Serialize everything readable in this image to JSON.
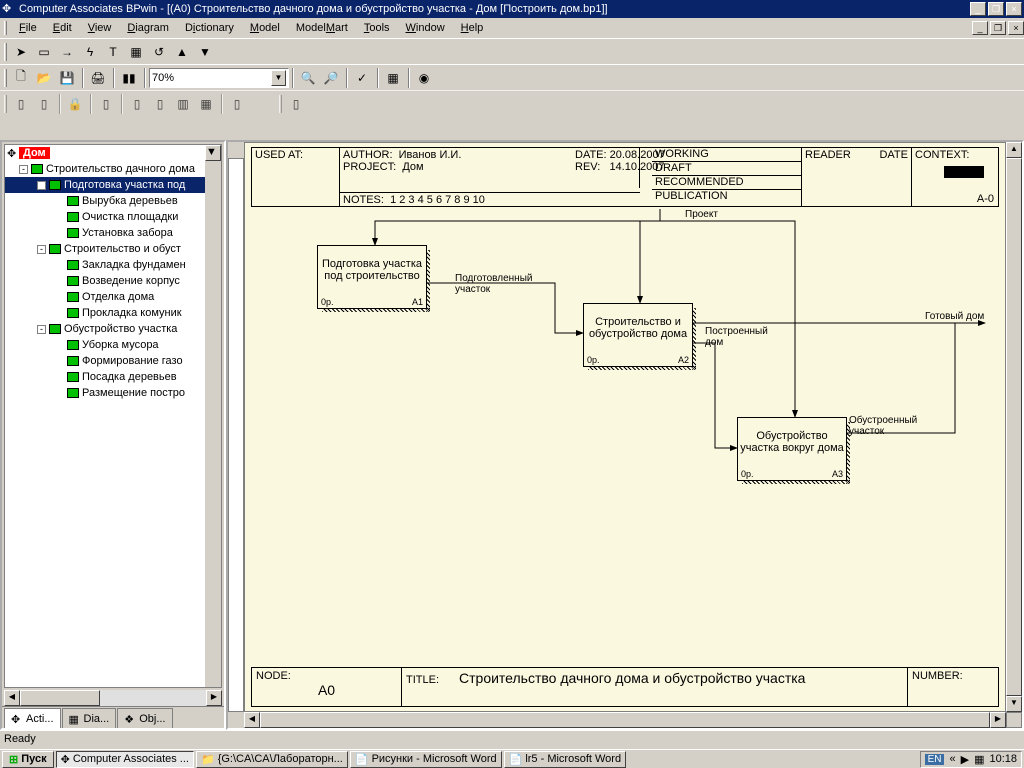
{
  "title": "Computer Associates BPwin - [(A0) Строительство дачного дома  и обустройство участка  - Дом  [Построить дом.bp1]]",
  "menu": {
    "file": "File",
    "edit": "Edit",
    "view": "View",
    "diagram": "Diagram",
    "dictionary": "Dictionary",
    "model": "Model",
    "modelmart": "ModelMart",
    "tools": "Tools",
    "window": "Window",
    "help": "Help"
  },
  "zoom": "70%",
  "tree": {
    "root": "Дом",
    "n1": "Строительство дачного дома",
    "n1_1": "Подготовка участка под",
    "n1_1_1": "Вырубка деревьев",
    "n1_1_2": "Очистка площадки",
    "n1_1_3": "Установка забора",
    "n1_2": "Строительство и обуст",
    "n1_2_1": "Закладка фундамен",
    "n1_2_2": "Возведение корпус",
    "n1_2_3": "Отделка дома",
    "n1_2_4": "Прокладка комуник",
    "n1_3": "Обустройство участка",
    "n1_3_1": "Уборка мусора",
    "n1_3_2": "Формирование газо",
    "n1_3_3": "Посадка деревьев",
    "n1_3_4": "Размещение постро"
  },
  "tabs": {
    "act": "Acti...",
    "dia": "Dia...",
    "obj": "Obj..."
  },
  "header": {
    "used_at": "USED AT:",
    "author_l": "AUTHOR:",
    "author": "Иванов И.И.",
    "project_l": "PROJECT:",
    "project": "Дом",
    "date_l": "DATE:",
    "date": "20.08.2007",
    "rev_l": "REV:",
    "rev": "14.10.2007",
    "working": "WORKING",
    "draft": "DRAFT",
    "recommended": "RECOMMENDED",
    "publication": "PUBLICATION",
    "reader": "READER",
    "hdate": "DATE",
    "context": "CONTEXT:",
    "notes_l": "NOTES:",
    "notes": "1  2  3  4  5  6  7  8  9  10",
    "a0": "A-0"
  },
  "footer": {
    "node_l": "NODE:",
    "node": "A0",
    "title_l": "TITLE:",
    "title": "Строительство дачного дома  и обустройство участка",
    "number_l": "NUMBER:"
  },
  "boxes": {
    "a1": {
      "t": "Подготовка участка под строительство",
      "bl": "0р.",
      "br": "A1"
    },
    "a2": {
      "t": "Строительство и обустройство дома",
      "bl": "0р.",
      "br": "A2"
    },
    "a3": {
      "t": "Обустройство участка вокруг дома",
      "bl": "0р.",
      "br": "A3"
    }
  },
  "labels": {
    "proekt": "Проект",
    "podgot": "Подготовленный участок",
    "postr": "Построенный дом",
    "obustr": "Обустроенный участок",
    "gotov": "Готовый дом"
  },
  "status": "Ready",
  "taskbar": {
    "start": "Пуск",
    "t1": "Computer Associates ...",
    "t2": "{G:\\CA\\CA\\Лабораторн...",
    "t3": "Рисунки - Microsoft Word",
    "t4": "lr5 - Microsoft Word",
    "lang": "EN",
    "clock": "10:18"
  }
}
